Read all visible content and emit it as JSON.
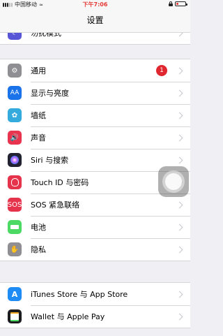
{
  "status_bar": {
    "carrier": "中国移动",
    "time": "下午7:06",
    "battery_level": 0.25
  },
  "nav": {
    "title": "设置"
  },
  "top_row": {
    "label": "勿扰模式"
  },
  "settings": [
    {
      "label": "通用",
      "icon": "gear-icon",
      "color": "#8e8e93",
      "badge": "1"
    },
    {
      "label": "显示与亮度",
      "icon": "display-brightness-icon",
      "color": "#1a73e8"
    },
    {
      "label": "墙纸",
      "icon": "wallpaper-flower-icon",
      "color": "#35aadc"
    },
    {
      "label": "声音",
      "icon": "speaker-icon",
      "color": "#e8344e"
    },
    {
      "label": "Siri 与搜索",
      "icon": "siri-icon",
      "color": "#222233"
    },
    {
      "label": "Touch ID 与密码",
      "icon": "fingerprint-icon",
      "color": "#e5334b"
    },
    {
      "label": "SOS 紧急联络",
      "icon": "sos-icon",
      "color": "#e5334b",
      "icon_text": "SOS"
    },
    {
      "label": "电池",
      "icon": "battery-icon",
      "color": "#4cd964"
    },
    {
      "label": "隐私",
      "icon": "hand-icon",
      "color": "#8e8e93"
    }
  ],
  "store": [
    {
      "label": "iTunes Store 与 App Store",
      "icon": "app-store-icon",
      "color": "#1f8cf5"
    },
    {
      "label": "Wallet 与 Apple Pay",
      "icon": "wallet-icon",
      "color": "#1c1c1e"
    }
  ]
}
